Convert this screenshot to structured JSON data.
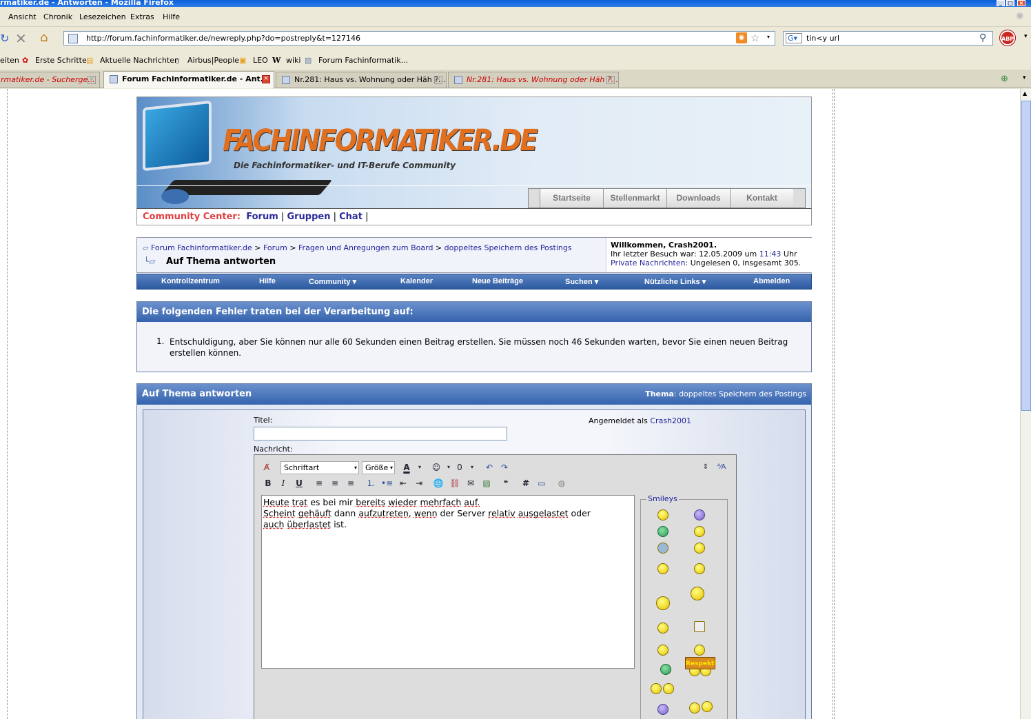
{
  "window": {
    "title": "rmatiker.de - Antworten - Mozilla Firefox"
  },
  "menu": [
    "Ansicht",
    "Chronik",
    "Lesezeichen",
    "Extras",
    "Hilfe"
  ],
  "url": "http://forum.fachinformatiker.de/newreply.php?do=postreply&t=127146",
  "search": "tin<y url",
  "bookmarks": [
    "eiten",
    "Erste Schritte",
    "Aktuelle Nachrichten",
    "Airbus|People",
    "LEO",
    "wiki",
    "Forum Fachinformatik..."
  ],
  "tabs": [
    {
      "label": "rmatiker.de - Sucherge...",
      "active": false
    },
    {
      "label": "Forum Fachinformatiker.de - Ant...",
      "active": true
    },
    {
      "label": "Nr.281: Haus vs. Wohnung oder Häh ?...",
      "active": false
    },
    {
      "label": "Nr.281: Haus vs. Wohnung oder Häh ?...",
      "active": false
    }
  ],
  "site": {
    "logo": "FACHINFORMATIKER.DE",
    "slogan": "Die Fachinformatiker- und IT-Berufe Community",
    "topnav": [
      "Startseite",
      "Stellenmarkt",
      "Downloads",
      "Kontakt"
    ],
    "community_label": "Community Center:",
    "community_links": [
      "Forum",
      "Gruppen",
      "Chat"
    ],
    "sep": "|"
  },
  "breadcrumb": {
    "items": [
      "Forum Fachinformatiker.de",
      "Forum",
      "Fragen und Anregungen zum Board",
      "doppeltes Speichern des Postings"
    ],
    "sep": ">",
    "title": "Auf Thema antworten"
  },
  "welcome": {
    "greeting": "Willkommen,",
    "user": "Crash2001",
    "dot": ".",
    "last_visit_label": "Ihr letzter Besuch war: 12.05.2009 um",
    "last_visit_time": "11:43",
    "uhr": "Uhr",
    "pm_label": "Private Nachrichten",
    "pm_text": ": Ungelesen 0, insgesamt 305."
  },
  "navstrip": [
    "Kontrollzentrum",
    "Hilfe",
    "Community ▾",
    "Kalender",
    "Neue Beiträge",
    "Suchen ▾",
    "Nützliche Links ▾",
    "Abmelden"
  ],
  "error": {
    "heading": "Die folgenden Fehler traten bei der Verarbeitung auf:",
    "num": "1.",
    "message": "Entschuldigung, aber Sie können nur alle 60 Sekunden einen Beitrag erstellen. Sie müssen noch 46 Sekunden warten, bevor Sie einen neuen Beitrag erstellen können."
  },
  "reply": {
    "heading": "Auf Thema antworten",
    "thema_label": "Thema",
    "thema": ": doppeltes Speichern des Postings",
    "titel_label": "Titel:",
    "logged_in_label": "Angemeldet als",
    "logged_in_user": "Crash2001",
    "nachricht_label": "Nachricht:",
    "font_select": "Schriftart",
    "size_select": "Größe",
    "smileys_legend": "Smileys",
    "respekt": "Respekt!",
    "text_lines": [
      "Heute trat es bei mir bereits wieder mehrfach auf.",
      "Scheint gehäuft dann aufzutreten, wenn der Server relativ ausgelastet oder",
      "auch überlastet ist."
    ]
  }
}
